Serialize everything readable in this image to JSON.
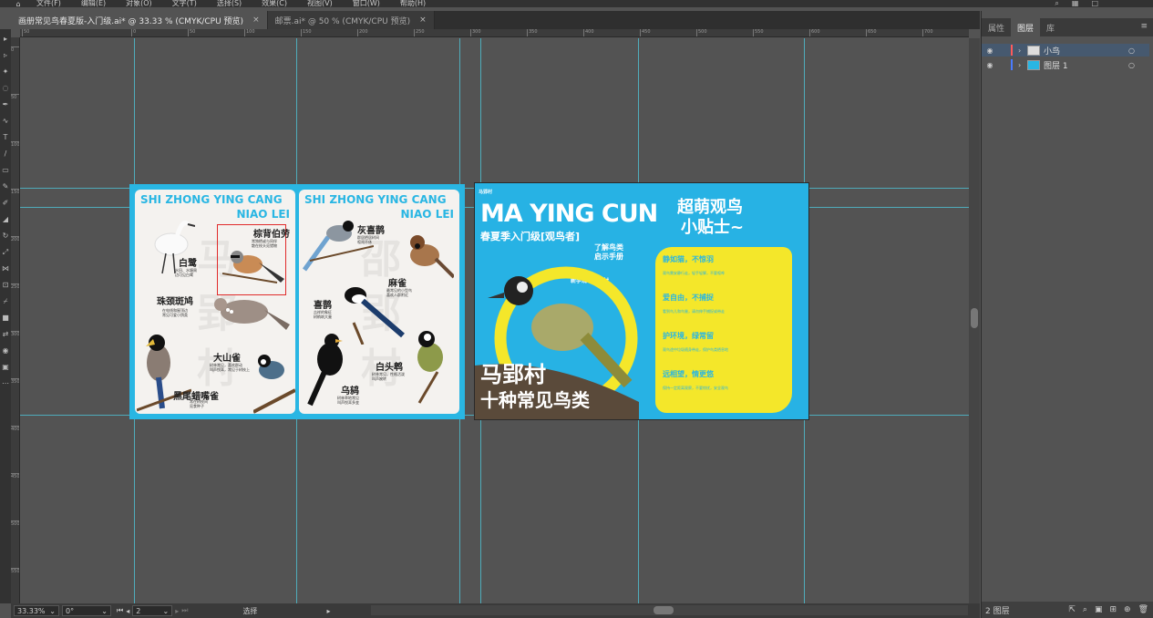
{
  "menubar": {
    "items": [
      "文件(F)",
      "编辑(E)",
      "对象(O)",
      "文字(T)",
      "选择(S)",
      "效果(C)",
      "视图(V)",
      "窗口(W)",
      "帮助(H)"
    ]
  },
  "tabs": [
    {
      "label": "画册常见鸟春夏版-入门级.ai* @ 33.33 % (CMYK/CPU 预览)"
    },
    {
      "label": "邮票.ai* @ 50 % (CMYK/CPU 预览)"
    }
  ],
  "ruler": {
    "h_ticks": [
      "50",
      "0",
      "50",
      "100",
      "150",
      "200",
      "250",
      "300",
      "350",
      "400",
      "450",
      "500",
      "550",
      "600",
      "650",
      "700"
    ],
    "v_ticks": [
      "0",
      "50",
      "100",
      "150",
      "200",
      "250",
      "300",
      "350",
      "400",
      "450",
      "500",
      "550"
    ]
  },
  "spread_left": {
    "head1": "SHI ZHONG YING CANG",
    "head2": "NIAO LEI",
    "head3": "SHI ZHONG YING CANG",
    "head4": "NIAO LEI",
    "birds": [
      {
        "name": "白鹭",
        "note": "水田、水塘周\n边可见白鹭"
      },
      {
        "name": "棕背伯劳",
        "note": "常独栖或与同伴\n散在枝头觅猎物"
      },
      {
        "name": "珠颈斑鸠",
        "note": "在电线和屋顶边\n常见可爱小鸽类"
      },
      {
        "name": "大山雀",
        "note": "树林常见，喜欢群动\n叫声悦耳，常见于树枝上"
      },
      {
        "name": "黑尾蜡嘴雀",
        "note": "常在树枝间\n觅食种子"
      },
      {
        "name": "灰喜鹊",
        "note": "群居栖居树间\n喧闹不休"
      },
      {
        "name": "麻雀",
        "note": "最常见的小型鸟\n喜欢人群附近"
      },
      {
        "name": "喜鹊",
        "note": "吉祥的象征\n树梢筑大巢"
      },
      {
        "name": "白头鹎",
        "note": "树林常见，性格活泼\n叫声婉转"
      },
      {
        "name": "乌鸫",
        "note": "树林草地常见\n叫声悦耳多变"
      }
    ]
  },
  "spread_right": {
    "logo": "马郢村",
    "title": "MA YING CUN",
    "subtitle": "春夏季入门级[观鸟者]",
    "sub2_line1": "了解鸟类",
    "sub2_line2": "启示手册",
    "sub3": "新手观鸟第一村",
    "big1": "马郢村",
    "big2": "十种常见鸟类",
    "tips_title1": "超萌观鸟",
    "tips_title2": "小贴士~",
    "tips": [
      {
        "h": "静如猫，不惊羽",
        "t": "观鸟需安静行走，轻手轻脚，不要喧哗"
      },
      {
        "h": "爱自由，不捕捉",
        "t": "看到鸟儿和鸟巢，请勿伸手捕捉或带走"
      },
      {
        "h": "护环境，绿常留",
        "t": "观鸟途中垃圾随身带走，保护鸟类栖息地"
      },
      {
        "h": "远相望，情更悠",
        "t": "保持一定距离观察，不要惊扰，安全观鸟"
      }
    ]
  },
  "panel": {
    "tabs": [
      "属性",
      "图层",
      "库"
    ],
    "layers": [
      {
        "name": "小鸟",
        "color": "#ff5a5a"
      },
      {
        "name": "图层 1",
        "color": "#4a7bff"
      }
    ],
    "footer_count": "2 图层"
  },
  "statusbar": {
    "zoom": "33.33%",
    "rotate": "0°",
    "page": "2",
    "tool_label": "选择"
  }
}
